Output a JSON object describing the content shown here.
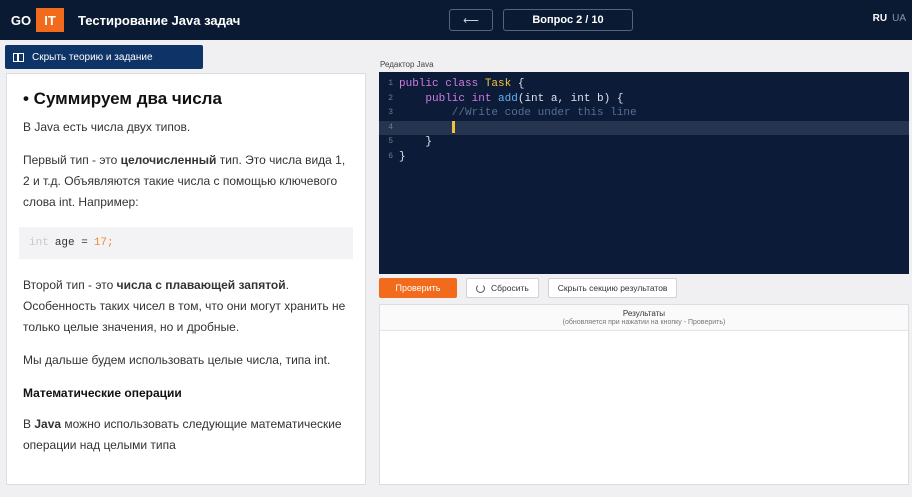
{
  "header": {
    "logo_left": "GO",
    "logo_right": "IT",
    "title": "Тестирование Java задач",
    "back_label": "⟵",
    "question_counter": "Вопрос 2 / 10",
    "lang_active": "RU",
    "lang_other": "UA"
  },
  "hide_button_label": "Скрыть теорию и задание",
  "theory": {
    "heading": "• Суммируем два числа",
    "p1": "В Java есть числа двух типов.",
    "p2_before": "Первый тип - это ",
    "p2_bold": "целочисленный",
    "p2_after": " тип. Это числа вида 1, 2 и т.д. Объявляются такие числа с помощью ключевого слова int. Например:",
    "code_kw": "int",
    "code_var": "age =",
    "code_num": "17;",
    "p3_before": "Второй тип - это ",
    "p3_bold": "числа с плавающей запятой",
    "p3_after": ". Особенность таких чисел в том, что они могут хранить не только целые значения, но и дробные.",
    "p4": "Мы дальше будем использовать целые числа, типа int.",
    "h3": "Математические операции",
    "p5_before": "В ",
    "p5_bold": "Java",
    "p5_after": " можно использовать следующие математические операции над целыми типа"
  },
  "editor": {
    "label": "Редактор Java",
    "lines": {
      "n1": "1",
      "n2": "2",
      "n3": "3",
      "n4": "4",
      "n5": "5",
      "n6": "6",
      "l1_kw": "public class ",
      "l1_cls": "Task",
      "l1_rest": " {",
      "l2_kw": "    public int ",
      "l2_fn": "add",
      "l2_rest": "(int a, int b) {",
      "l3_cm": "        //Write code under this line",
      "l5": "    }",
      "l6": "}"
    }
  },
  "buttons": {
    "check": "Проверить",
    "reset": "Сбросить",
    "hide_results": "Скрыть секцию результатов"
  },
  "results": {
    "title": "Результаты",
    "subtitle": "(обновляется при нажатии на кнопку - Проверить)"
  }
}
